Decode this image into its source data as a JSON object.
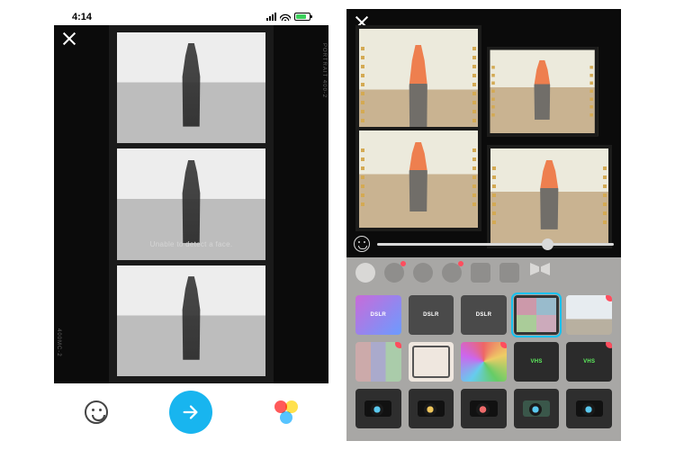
{
  "status": {
    "time": "4:14"
  },
  "colors": {
    "accent": "#18b5ef",
    "selection": "#18c2ef",
    "notify": "#ff4d5e"
  },
  "phone1": {
    "overlay_text": "Unable to detect a face.",
    "frame_labels": {
      "right": "PORTRAIT 400-2",
      "left": "400MC-2"
    }
  },
  "phone2": {
    "slider": {
      "value": 0.72
    },
    "tool_row": [
      {
        "name": "stickers",
        "notify": false
      },
      {
        "name": "beauty",
        "notify": true
      },
      {
        "name": "magic",
        "notify": false
      },
      {
        "name": "sparkle",
        "notify": true
      },
      {
        "name": "camera",
        "notify": false
      },
      {
        "name": "collage",
        "notify": false
      },
      {
        "name": "frames",
        "notify": false
      }
    ],
    "presets": [
      {
        "name": "dslr-purple",
        "label": "DSLR",
        "cls": "dslr-p",
        "selected": false
      },
      {
        "name": "dslr-1",
        "label": "DSLR",
        "cls": "dslr-1",
        "selected": false
      },
      {
        "name": "dslr-2",
        "label": "DSLR",
        "cls": "dslr-2",
        "selected": false
      },
      {
        "name": "film-quad",
        "label": "",
        "cls": "film4",
        "selected": true
      },
      {
        "name": "wide",
        "label": "",
        "cls": "wide",
        "selected": false,
        "badge": true
      },
      {
        "name": "retro-strip",
        "label": "",
        "cls": "retro",
        "selected": false,
        "badge": true
      },
      {
        "name": "crt",
        "label": "",
        "cls": "crt",
        "selected": false
      },
      {
        "name": "paint",
        "label": "",
        "cls": "paint",
        "selected": false,
        "badge": true
      },
      {
        "name": "vhs-1",
        "label": "VHS",
        "cls": "vhs1",
        "selected": false
      },
      {
        "name": "vhs-2",
        "label": "VHS",
        "cls": "vhs2",
        "selected": false,
        "badge": true
      },
      {
        "name": "cam-1",
        "label": "",
        "cls": "cam",
        "selected": false
      },
      {
        "name": "cam-2",
        "label": "",
        "cls": "cam c2",
        "selected": false
      },
      {
        "name": "cam-3",
        "label": "",
        "cls": "cam c3",
        "selected": false
      },
      {
        "name": "cam-4",
        "label": "",
        "cls": "cam c4",
        "selected": false
      },
      {
        "name": "cam-5",
        "label": "",
        "cls": "cam",
        "selected": false
      }
    ]
  }
}
